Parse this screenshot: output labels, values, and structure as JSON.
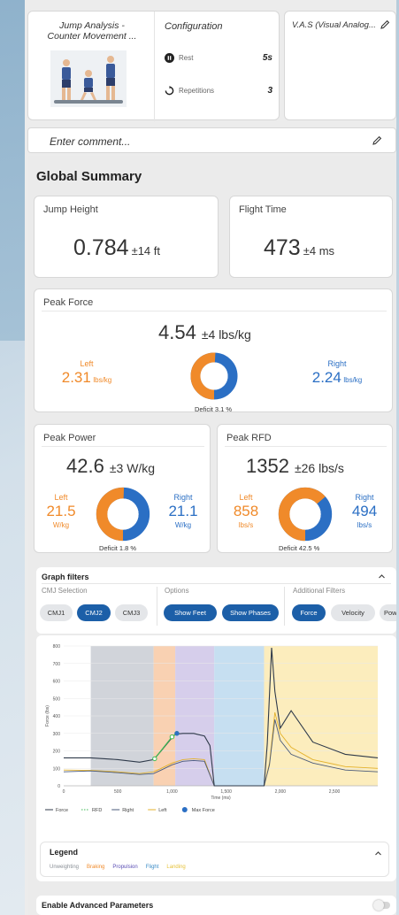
{
  "exercise": {
    "title_line1": "Jump Analysis -",
    "title_line2": "Counter Movement ..."
  },
  "configuration": {
    "title": "Configuration",
    "rest_label": "Rest",
    "rest_value": "5s",
    "repetitions_label": "Repetitions",
    "repetitions_value": "3"
  },
  "vas": {
    "title": "V.A.S (Visual Analog..."
  },
  "comment": {
    "placeholder": "Enter comment..."
  },
  "global_summary": {
    "title": "Global Summary",
    "jump_height": {
      "label": "Jump Height",
      "value": "0.784",
      "deviation": "±14 ft"
    },
    "flight_time": {
      "label": "Flight Time",
      "value": "473",
      "deviation": "±4 ms"
    },
    "peak_force": {
      "label": "Peak Force",
      "value": "4.54",
      "deviation": "±4 lbs/kg",
      "left_label": "Left",
      "left_value": "2.31",
      "left_unit": "lbs/kg",
      "right_label": "Right",
      "right_value": "2.24",
      "right_unit": "lbs/kg",
      "deficit": "Deficit 3.1 %",
      "left_share": 0.508
    },
    "peak_power": {
      "label": "Peak Power",
      "value": "42.6",
      "deviation": "±3 W/kg",
      "left_label": "Left",
      "left_value": "21.5",
      "left_unit": "W/kg",
      "right_label": "Right",
      "right_value": "21.1",
      "right_unit": "W/kg",
      "deficit": "Deficit 1.8 %",
      "left_share": 0.505
    },
    "peak_rfd": {
      "label": "Peak RFD",
      "value": "1352",
      "deviation": "±26 lbs/s",
      "left_label": "Left",
      "left_value": "858",
      "left_unit": "lbs/s",
      "right_label": "Right",
      "right_value": "494",
      "right_unit": "lbs/s",
      "deficit": "Deficit 42.5 %",
      "left_share": 0.635
    }
  },
  "graph_filters": {
    "title": "Graph filters",
    "cmj_selection_label": "CMJ Selection",
    "cmj": [
      "CMJ1",
      "CMJ2",
      "CMJ3"
    ],
    "options_label": "Options",
    "show_feet": "Show Feet",
    "show_phases": "Show Phases",
    "additional_label": "Additional Filters",
    "force": "Force",
    "velocity": "Velocity",
    "power": "Pow"
  },
  "chart_data": {
    "type": "line",
    "ylabel": "Force (lbs)",
    "xlabel": "Time (ms)",
    "x_ticks": [
      "0",
      "500",
      "1,000",
      "1,500",
      "2,000",
      "2,500"
    ],
    "y_ticks": [
      "0",
      "100",
      "200",
      "300",
      "400",
      "500",
      "600",
      "700",
      "800"
    ],
    "xlim": [
      0,
      2900
    ],
    "ylim": [
      0,
      800
    ],
    "phases": [
      {
        "name": "Unweighting",
        "start": 250,
        "end": 830,
        "color": "#c9cdd3"
      },
      {
        "name": "Braking",
        "start": 830,
        "end": 1030,
        "color": "#f8c9a4"
      },
      {
        "name": "Propulsion",
        "start": 1030,
        "end": 1390,
        "color": "#cfc5e8"
      },
      {
        "name": "Flight",
        "start": 1390,
        "end": 1850,
        "color": "#bcd9ee"
      },
      {
        "name": "Landing",
        "start": 1850,
        "end": 2900,
        "color": "#fbeab1"
      }
    ],
    "series": [
      {
        "name": "Force",
        "color": "#2f3a4a",
        "x": [
          0,
          250,
          500,
          700,
          830,
          900,
          1000,
          1030,
          1100,
          1200,
          1300,
          1350,
          1390,
          1850,
          1880,
          1920,
          1950,
          2000,
          2100,
          2300,
          2600,
          2900
        ],
        "y": [
          160,
          160,
          150,
          135,
          150,
          200,
          275,
          295,
          300,
          300,
          285,
          230,
          0,
          0,
          240,
          790,
          540,
          330,
          430,
          250,
          180,
          160
        ]
      },
      {
        "name": "Right",
        "color": "#4a5a7a",
        "x": [
          0,
          250,
          500,
          700,
          830,
          900,
          1000,
          1100,
          1200,
          1300,
          1390,
          1850,
          1900,
          1950,
          2000,
          2100,
          2300,
          2600,
          2900
        ],
        "y": [
          80,
          85,
          75,
          65,
          70,
          90,
          120,
          140,
          145,
          140,
          0,
          0,
          120,
          380,
          260,
          180,
          130,
          90,
          80
        ]
      },
      {
        "name": "Left",
        "color": "#e3b12b",
        "x": [
          0,
          250,
          500,
          700,
          830,
          900,
          1000,
          1100,
          1200,
          1300,
          1390,
          1850,
          1900,
          1950,
          2000,
          2100,
          2300,
          2600,
          2900
        ],
        "y": [
          90,
          88,
          80,
          70,
          80,
          100,
          130,
          150,
          155,
          150,
          0,
          0,
          130,
          420,
          300,
          220,
          150,
          110,
          100
        ]
      }
    ],
    "rfd_points": [
      {
        "x": 840,
        "y": 155
      },
      {
        "x": 1000,
        "y": 280
      },
      {
        "x": 1045,
        "y": 300
      }
    ],
    "max_force": {
      "x": 1045,
      "y": 300
    },
    "legend_items": [
      "Force",
      "RFD",
      "Right",
      "Left",
      "Max Force"
    ]
  },
  "phase_legend": {
    "title": "Legend",
    "items": [
      "Unweighting",
      "Braking",
      "Propulsion",
      "Flight",
      "Landing"
    ],
    "colors": [
      "#8a8f96",
      "#f08a2a",
      "#5b4fb5",
      "#3c8cc6",
      "#e6c23a"
    ]
  },
  "advanced": {
    "label": "Enable Advanced Parameters"
  }
}
